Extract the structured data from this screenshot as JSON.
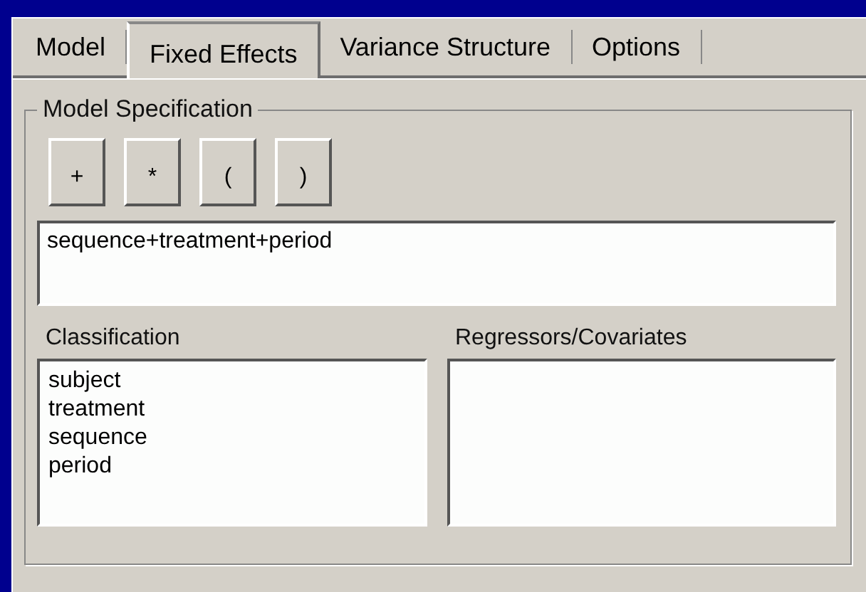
{
  "tabs": [
    {
      "label": "Model",
      "selected": false
    },
    {
      "label": "Fixed Effects",
      "selected": true
    },
    {
      "label": "Variance Structure",
      "selected": false
    },
    {
      "label": "Options",
      "selected": false
    }
  ],
  "group": {
    "title": "Model Specification",
    "operator_buttons": [
      "+",
      "*",
      "(",
      ")"
    ],
    "model_field": {
      "value": "sequence+treatment+period"
    },
    "classification": {
      "label": "Classification",
      "items": [
        "subject",
        "treatment",
        "sequence",
        "period"
      ]
    },
    "regressors": {
      "label": "Regressors/Covariates"
    }
  }
}
